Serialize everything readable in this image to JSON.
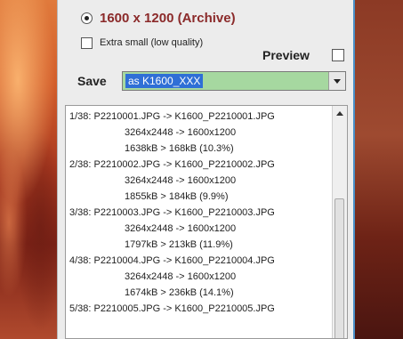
{
  "options": {
    "resolution_label": "1600 x 1200 (Archive)",
    "resolution_selected": true,
    "extra_small_label": "Extra small (low quality)",
    "extra_small_checked": false,
    "preview_label": "Preview",
    "preview_checked": false
  },
  "save": {
    "label": "Save",
    "value": "as K1600_XXX"
  },
  "log": {
    "lines": [
      "1/38: P2210001.JPG -> K1600_P2210001.JPG",
      "3264x2448 -> 1600x1200",
      "1638kB > 168kB (10.3%)",
      "2/38: P2210002.JPG -> K1600_P2210002.JPG",
      "3264x2448 -> 1600x1200",
      "1855kB > 184kB (9.9%)",
      "3/38: P2210003.JPG -> K1600_P2210003.JPG",
      "3264x2448 -> 1600x1200",
      "1797kB > 213kB (11.9%)",
      "4/38: P2210004.JPG -> K1600_P2210004.JPG",
      "3264x2448 -> 1600x1200",
      "1674kB > 236kB (14.1%)",
      "5/38: P2210005.JPG -> K1600_P2210005.JPG"
    ]
  },
  "icons": {
    "radio": "radio-selected-icon",
    "checkbox": "checkbox-icon",
    "dropdown": "chevron-down-icon",
    "scroll_up": "scroll-up-arrow-icon"
  },
  "colors": {
    "resolution_text": "#8b2a2a",
    "save_field_bg": "#a6d8a0",
    "selection_bg": "#2f6fd6",
    "window_border": "#4a90c8"
  }
}
